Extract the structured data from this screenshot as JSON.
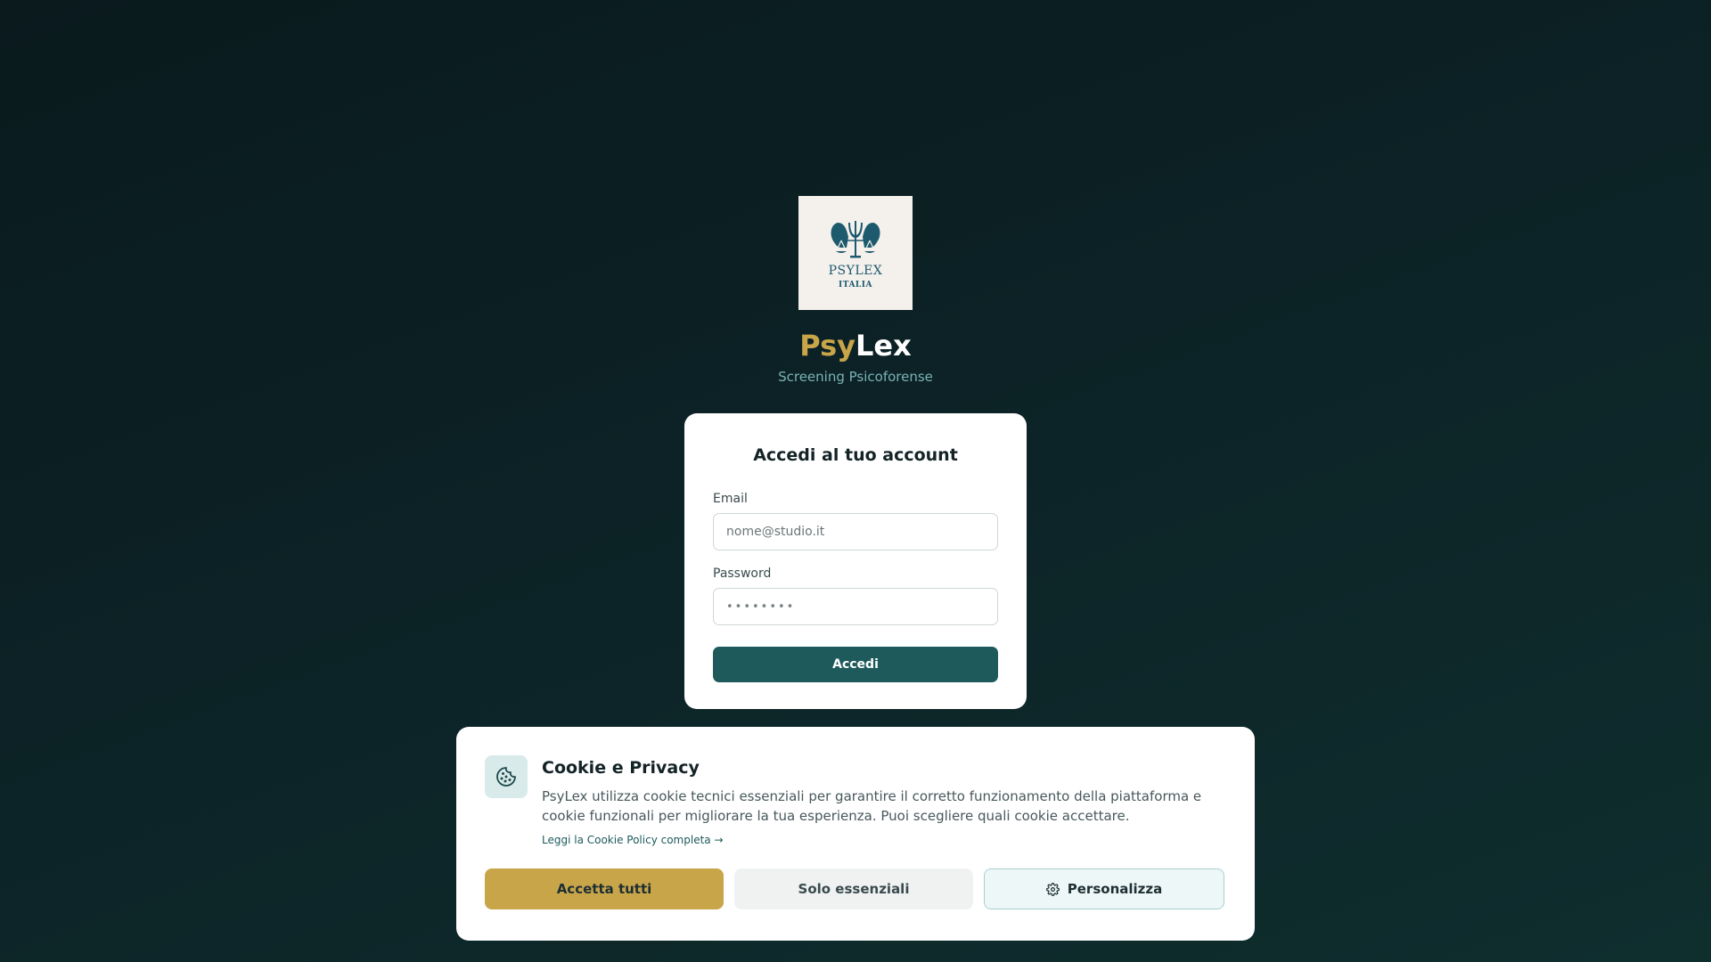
{
  "brand": {
    "logo_line1": "PSYLEX",
    "logo_line2": "ITALIA",
    "title_part1": "Psy",
    "title_part2": "Lex",
    "subtitle": "Screening Psicoforense",
    "icons": {
      "logo": "psi-scales-logo-icon"
    }
  },
  "login": {
    "heading": "Accedi al tuo account",
    "email_label": "Email",
    "email_placeholder": "nome@studio.it",
    "password_label": "Password",
    "password_value": "••••••••",
    "submit_label": "Accedi",
    "colors": {
      "button": "#1e5a5c"
    }
  },
  "cookie": {
    "title": "Cookie e Privacy",
    "text": "PsyLex utilizza cookie tecnici essenziali per garantire il corretto funzionamento della piattaforma e cookie funzionali per migliorare la tua esperienza. Puoi scegliere quali cookie accettare.",
    "policy_link": "Leggi la Cookie Policy completa →",
    "accept_all": "Accetta tutti",
    "essential_only": "Solo essenziali",
    "customize": "Personalizza",
    "icons": {
      "cookie": "cookie-icon",
      "customize": "gear-icon"
    },
    "colors": {
      "accent": "#c9a54a"
    }
  }
}
